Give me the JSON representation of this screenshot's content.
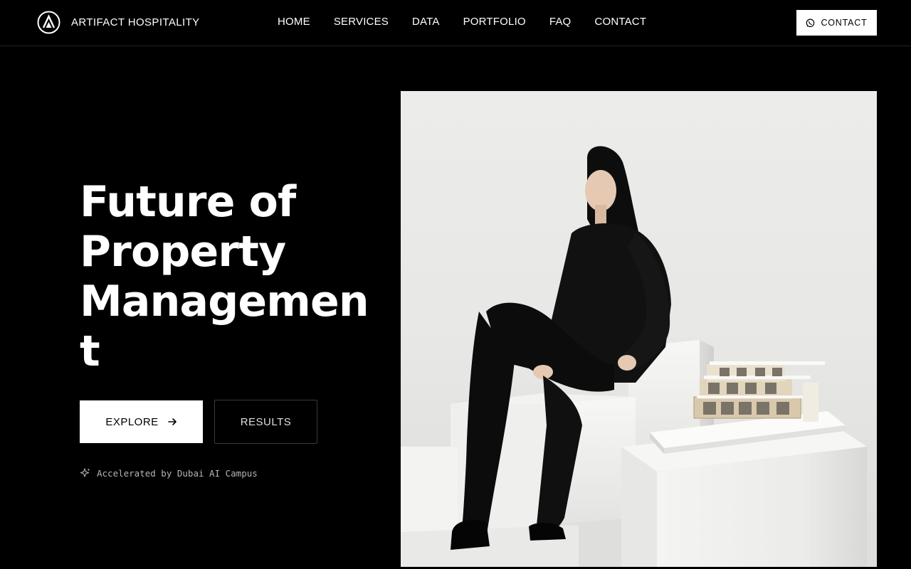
{
  "header": {
    "brand_name": "ARTIFACT HOSPITALITY",
    "brand_logo": "triangle-a-logo",
    "nav": [
      {
        "label": "HOME"
      },
      {
        "label": "SERVICES"
      },
      {
        "label": "DATA"
      },
      {
        "label": "PORTFOLIO"
      },
      {
        "label": "FAQ"
      },
      {
        "label": "CONTACT"
      }
    ],
    "contact_button": {
      "label": "CONTACT",
      "icon": "whatsapp-icon"
    }
  },
  "hero": {
    "title_lines": [
      "Future of",
      "Property",
      "Managemen",
      "t"
    ],
    "explore_button": {
      "label": "EXPLORE",
      "icon": "arrow-right-icon"
    },
    "results_button": {
      "label": "RESULTS"
    },
    "badge": {
      "text": "Accelerated by Dubai AI Campus",
      "icon": "sparkle-icon"
    },
    "image": {
      "subject": "woman-seated-beside-architectural-model"
    }
  },
  "colors": {
    "background": "#000000",
    "text": "#ffffff",
    "button_primary_bg": "#ffffff",
    "button_secondary_border": "#3a3a3a",
    "badge_text": "#b5b5b5",
    "image_backdrop": "#e9e9e7"
  }
}
